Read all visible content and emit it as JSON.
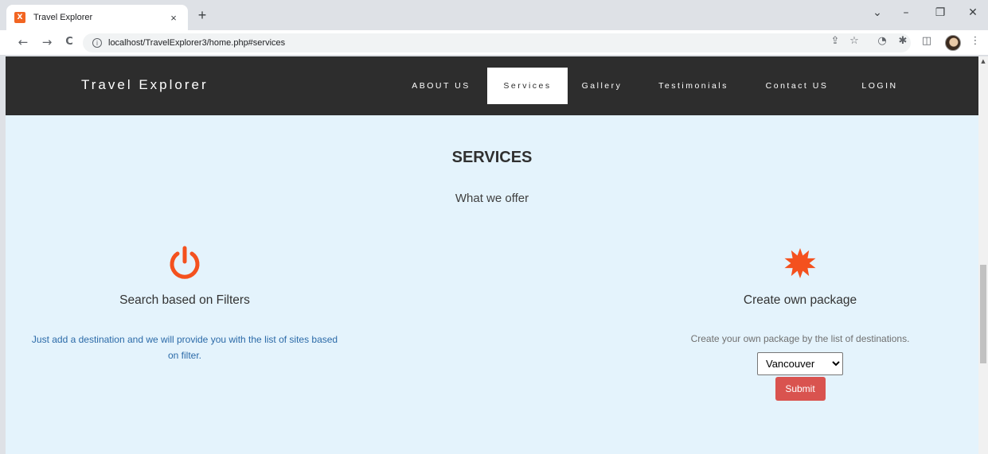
{
  "browser": {
    "tab_title": "Travel Explorer",
    "tab_close": "×",
    "new_tab": "+",
    "url": "localhost/TravelExplorer3/home.php#services",
    "favicon_text": "X",
    "controls": {
      "dropdown": "⌄",
      "minimize": "–",
      "restore": "❐",
      "close": "✕"
    },
    "nav": {
      "back": "←",
      "forward": "→",
      "reload": "C"
    }
  },
  "navbar": {
    "brand": "Travel Explorer",
    "links": [
      {
        "label": "ABOUT US",
        "active": false
      },
      {
        "label": "Services",
        "active": true
      },
      {
        "label": "Gallery",
        "active": false
      },
      {
        "label": "Testimonials",
        "active": false
      },
      {
        "label": "Contact US",
        "active": false
      },
      {
        "label": "LOGIN",
        "active": false
      }
    ]
  },
  "services": {
    "title": "SERVICES",
    "subtitle": "What we offer",
    "features": [
      {
        "icon": "power-icon",
        "title": "Search based on Filters",
        "description": "Just add a destination and we will provide you with the list of sites based on filter."
      },
      {
        "icon": "starburst-icon",
        "title": "Create own package",
        "description": "Create your own package by the list of destinations.",
        "select_value": "Vancouver",
        "submit_label": "Submit"
      }
    ]
  },
  "colors": {
    "navbar_bg": "#2d2d2d",
    "page_bg": "#e4f3fc",
    "icon_accent": "#f4511e",
    "link_blue": "#2b6aa8",
    "submit_bg": "#d9534f"
  }
}
